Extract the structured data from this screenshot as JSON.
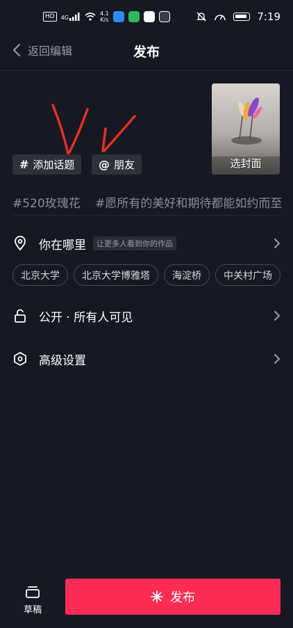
{
  "status_bar": {
    "hd_label": "HD",
    "net_label": "4G",
    "speed_value": "4.1",
    "speed_unit": "K/s",
    "time": "7:19",
    "icons": [
      "hd-icon",
      "signal-icon",
      "wifi-icon",
      "search-app-icon",
      "green-app-icon",
      "qq-icon",
      "shield-app-icon",
      "mute-icon",
      "speedometer-icon",
      "battery-icon"
    ]
  },
  "header": {
    "back_label": "返回编辑",
    "title": "发布"
  },
  "cover": {
    "label": "选封面"
  },
  "actions": {
    "topic_symbol": "#",
    "topic_label": "添加话题",
    "friend_symbol": "@",
    "friend_label": "朋友"
  },
  "caption": {
    "hashtags": [
      "#520玫瑰花",
      "#愿所有的美好和期待都能如约而至"
    ]
  },
  "location": {
    "label": "你在哪里",
    "hint": "让更多人看到你的作品",
    "suggestions": [
      "北京大学",
      "北京大学博雅塔",
      "海淀桥",
      "中关村广场"
    ]
  },
  "privacy": {
    "label": "公开 · 所有人可见"
  },
  "advanced": {
    "label": "高级设置"
  },
  "bottom": {
    "draft_label": "草稿",
    "publish_label": "发布"
  },
  "colors": {
    "background": "#161824",
    "accent": "#fe2c55",
    "chip_bg": "#2e303c",
    "annotation_red": "#e5311e"
  }
}
